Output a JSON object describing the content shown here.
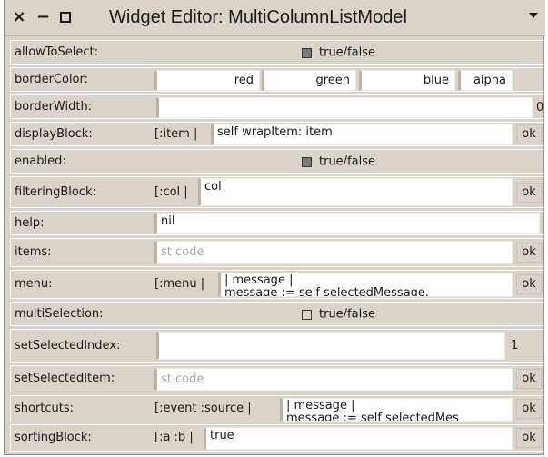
{
  "window": {
    "title": "Widget Editor: MultiColumnListModel",
    "close_glyph": "×",
    "minimize_glyph": "−"
  },
  "rows": {
    "allowToSelect": {
      "label": "allowToSelect:",
      "checked": true,
      "checkbox_label": "true/false"
    },
    "borderColor": {
      "label": "borderColor:",
      "red": "red",
      "green": "green",
      "blue": "blue",
      "alpha": "alpha"
    },
    "borderWidth": {
      "label": "borderWidth:",
      "value": "",
      "trailing": "0"
    },
    "displayBlock": {
      "label": "displayBlock:",
      "prefix": "[:item |",
      "value": "self wrapItem: item",
      "ok": "ok"
    },
    "enabled": {
      "label": "enabled:",
      "checked": true,
      "checkbox_label": "true/false"
    },
    "filteringBlock": {
      "label": "filteringBlock:",
      "prefix": "[:col |",
      "value": "col",
      "ok": "ok"
    },
    "help": {
      "label": "help:",
      "value": "nil"
    },
    "items": {
      "label": "items:",
      "placeholder": "st code",
      "ok": "ok"
    },
    "menu": {
      "label": "menu:",
      "prefix": "[:menu |",
      "value_line1": "| message |",
      "value_line2": "message := self selectedMessage.",
      "ok": "ok"
    },
    "multiSelection": {
      "label": "multiSelection:",
      "checked": false,
      "checkbox_label": "true/false"
    },
    "setSelectedIndex": {
      "label": "setSelectedIndex:",
      "value": "",
      "trailing": "1"
    },
    "setSelectedItem": {
      "label": "setSelectedItem:",
      "placeholder": "st code",
      "ok": "ok"
    },
    "shortcuts": {
      "label": "shortcuts:",
      "prefix": "[:event :source |",
      "value_line1": "| message |",
      "value_line2": "message := self selectedMes",
      "ok": "ok"
    },
    "sortingBlock": {
      "label": "sortingBlock:",
      "prefix": "[:a :b |",
      "value": "true",
      "ok": "ok"
    }
  }
}
